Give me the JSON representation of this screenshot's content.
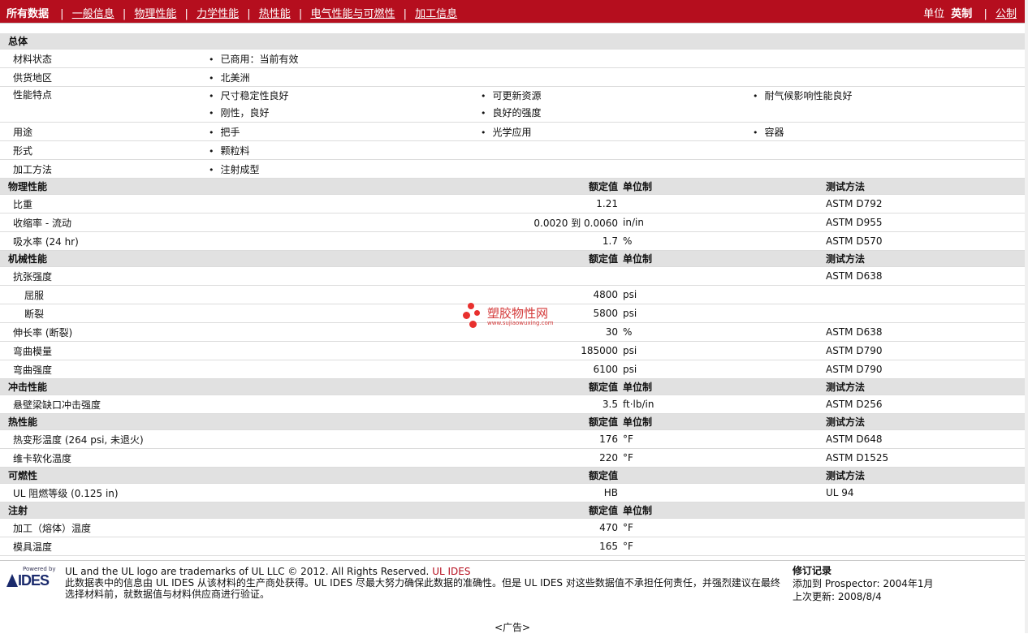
{
  "nav": {
    "all": "所有数据",
    "links": [
      "一般信息",
      "物理性能",
      "力学性能",
      "热性能",
      "电气性能与可燃性",
      "加工信息"
    ],
    "units_label": "单位",
    "unit_current": "英制",
    "unit_other": "公制"
  },
  "general": {
    "title": "总体",
    "rows": [
      {
        "label": "材料状态",
        "items": [
          "已商用：当前有效"
        ]
      },
      {
        "label": "供货地区",
        "items": [
          "北美洲"
        ]
      },
      {
        "label": "性能特点",
        "items": [
          "尺寸稳定性良好",
          "可更新资源",
          "耐气候影响性能良好",
          "刚性，良好",
          "良好的强度"
        ]
      },
      {
        "label": "用途",
        "items": [
          "把手",
          "光学应用",
          "容器"
        ]
      },
      {
        "label": "形式",
        "items": [
          "颗粒料"
        ]
      },
      {
        "label": "加工方法",
        "items": [
          "注射成型"
        ]
      }
    ]
  },
  "headers": {
    "value": "额定值",
    "unit": "单位制",
    "method": "测试方法"
  },
  "physical": {
    "title": "物理性能",
    "rows": [
      {
        "name": "比重",
        "value": "1.21",
        "unit": "",
        "method": "ASTM D792"
      },
      {
        "name": "收缩率 - 流动",
        "value": "0.0020 到  0.0060",
        "unit": "in/in",
        "method": "ASTM D955"
      },
      {
        "name": "吸水率 (24 hr)",
        "value": "1.7",
        "unit": "%",
        "method": "ASTM D570"
      }
    ]
  },
  "mechanical": {
    "title": "机械性能",
    "rows": [
      {
        "name": "抗张强度",
        "value": "",
        "unit": "",
        "method": "ASTM D638"
      },
      {
        "name": "屈服",
        "value": "4800",
        "unit": "psi",
        "method": ""
      },
      {
        "name": "断裂",
        "value": "5800",
        "unit": "psi",
        "method": ""
      },
      {
        "name": "伸长率 (断裂)",
        "value": "30",
        "unit": "%",
        "method": "ASTM D638"
      },
      {
        "name": "弯曲模量",
        "value": "185000",
        "unit": "psi",
        "method": "ASTM D790"
      },
      {
        "name": "弯曲强度",
        "value": "6100",
        "unit": "psi",
        "method": "ASTM D790"
      }
    ]
  },
  "impact": {
    "title": "冲击性能",
    "rows": [
      {
        "name": "悬壁梁缺口冲击强度",
        "value": "3.5",
        "unit": "ft·lb/in",
        "method": "ASTM D256"
      }
    ]
  },
  "thermal": {
    "title": "热性能",
    "rows": [
      {
        "name": "热变形温度 (264 psi, 未退火)",
        "value": "176",
        "unit": "°F",
        "method": "ASTM D648"
      },
      {
        "name": "维卡软化温度",
        "value": "220",
        "unit": "°F",
        "method": "ASTM D1525"
      }
    ]
  },
  "flammability": {
    "title": "可燃性",
    "rows": [
      {
        "name": "UL 阻燃等级 (0.125 in)",
        "value": "HB",
        "unit": "",
        "method": "UL 94"
      }
    ]
  },
  "injection": {
    "title": "注射",
    "rows": [
      {
        "name": "加工（熔体）温度",
        "value": "470",
        "unit": "°F",
        "method": ""
      },
      {
        "name": "模具温度",
        "value": "165",
        "unit": "°F",
        "method": ""
      }
    ]
  },
  "watermark": {
    "text": "塑胶物性网",
    "url": "www.sujiaowuxing.com"
  },
  "footer": {
    "logo_small": "Powered by",
    "logo_main": "IDES",
    "trademark": "UL and the UL logo are trademarks of UL LLC © 2012. All Rights Reserved.",
    "trademark_link": "UL IDES",
    "disclaimer": "此数据表中的信息由  UL IDES 从该材料的生产商处获得。UL IDES 尽最大努力确保此数据的准确性。但是  UL IDES 对这些数据值不承担任何责任，并强烈建议在最终选择材料前，就数据值与材料供应商进行验证。",
    "rev_title": "修订记录",
    "rev_added": "添加到  Prospector:    2004年1月",
    "rev_updated": "上次更新:      2008/8/4"
  },
  "ad": "<广告>"
}
